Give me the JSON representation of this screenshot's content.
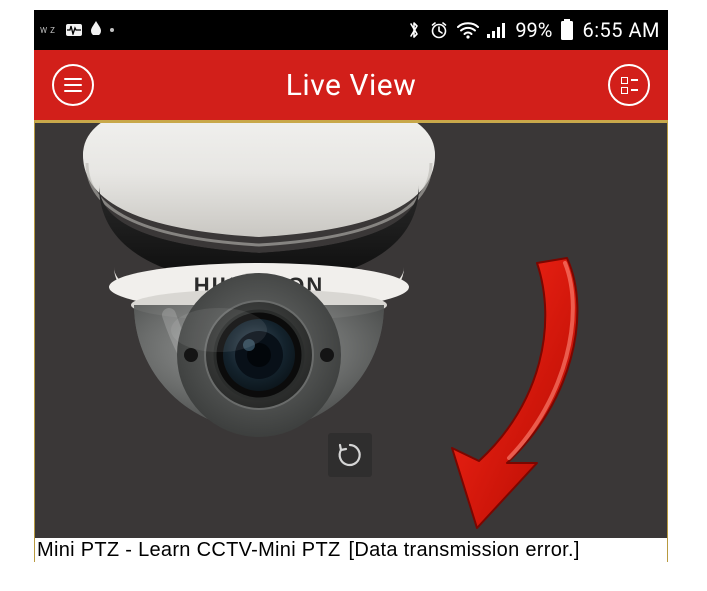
{
  "statusbar": {
    "left_label": "WZ",
    "battery_pct": "99%",
    "clock": "6:55 AM"
  },
  "header": {
    "title": "Live View"
  },
  "camera": {
    "brand": "HIKVISION"
  },
  "caption": {
    "camera_label": "Mini PTZ - Learn CCTV-Mini PTZ",
    "error": "[Data transmission error.]"
  }
}
